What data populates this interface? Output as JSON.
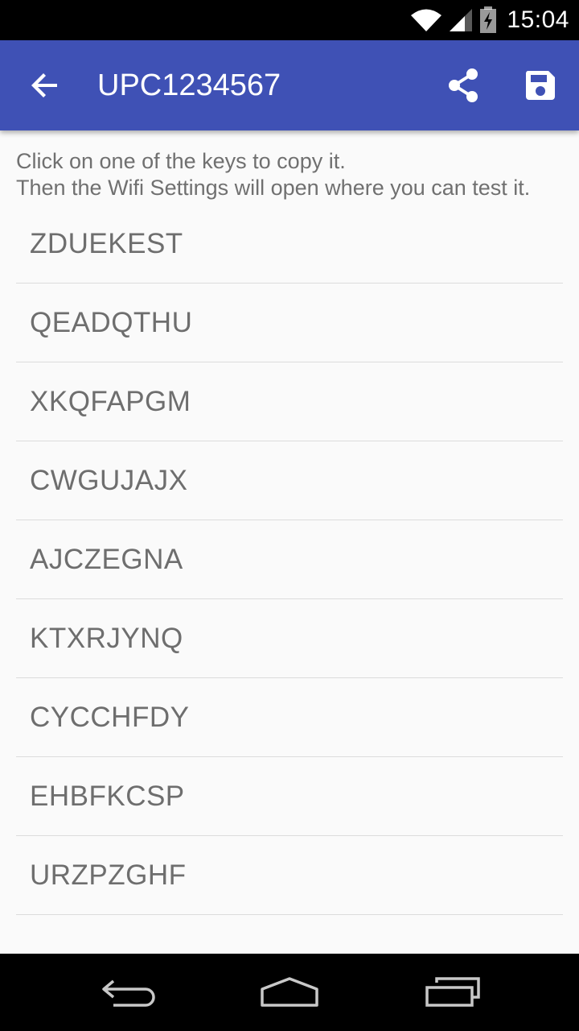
{
  "status_bar": {
    "time": "15:04",
    "icons": [
      "wifi-icon",
      "cell-signal-icon",
      "battery-charging-icon"
    ]
  },
  "toolbar": {
    "title": "UPC1234567",
    "icons": [
      "back-arrow-icon",
      "share-icon",
      "save-icon"
    ]
  },
  "instructions": {
    "line1": "Click on one of the keys to copy it.",
    "line2": "Then the Wifi Settings will open where you can test it."
  },
  "keys": [
    "ZDUEKEST",
    "QEADQTHU",
    "XKQFAPGM",
    "CWGUJAJX",
    "AJCZEGNA",
    "KTXRJYNQ",
    "CYCCHFDY",
    "EHBFKCSP",
    "URZPZGHF"
  ],
  "nav_bar": {
    "icons": [
      "back-icon",
      "home-icon",
      "recents-icon"
    ]
  },
  "colors": {
    "primary": "#3f51b5",
    "background": "#fafafa",
    "text": "#6e6e6e"
  }
}
